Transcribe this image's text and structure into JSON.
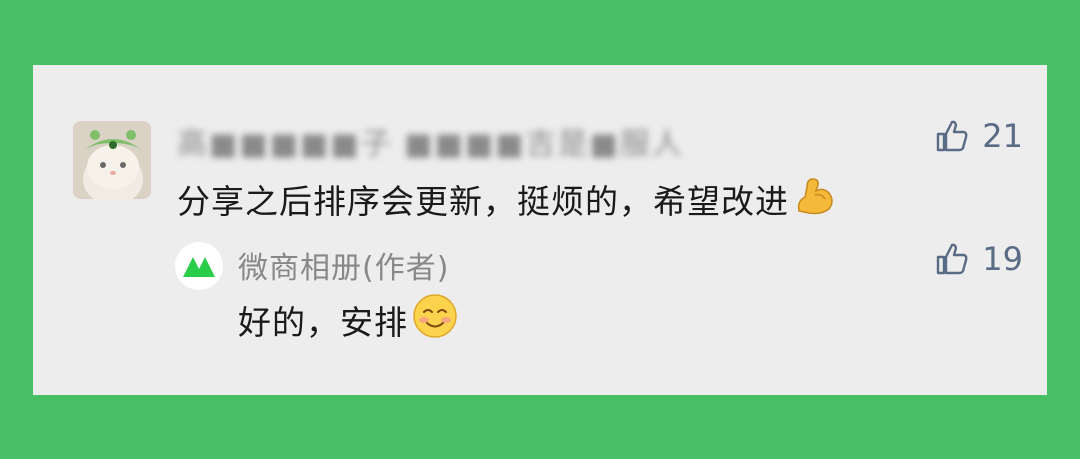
{
  "comment": {
    "author_blurred": "高■■■■■子 ■■■■吉是■服人",
    "text": "分享之后排序会更新，挺烦的，希望改进",
    "emoji_icon": "flexed-biceps-icon",
    "like_count": "21"
  },
  "reply": {
    "author": "微商相册(作者)",
    "text": "好的，安排",
    "emoji_icon": "smiling-face-icon",
    "like_count": "19",
    "avatar_icon": "mountain-logo-icon"
  },
  "colors": {
    "background": "#48c066",
    "card": "#ededed",
    "like": "#5a6b86",
    "logo_green": "#2bcc4a"
  }
}
